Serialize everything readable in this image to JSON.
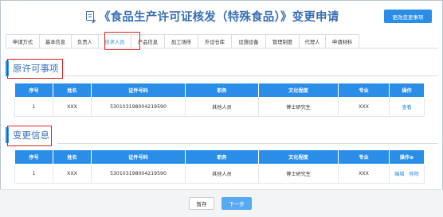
{
  "header": {
    "title": "《食品生产许可证核发（特殊食品）》变更申请",
    "change_button": "更改变更事项"
  },
  "tabs": [
    {
      "label": "申请方式"
    },
    {
      "label": "基本信息"
    },
    {
      "label": "负责人"
    },
    {
      "label": "技术人员"
    },
    {
      "label": "产品信息"
    },
    {
      "label": "加工场所"
    },
    {
      "label": "外设仓库"
    },
    {
      "label": "设施设备"
    },
    {
      "label": "管理制度"
    },
    {
      "label": "代理人"
    },
    {
      "label": "申请材料"
    }
  ],
  "active_tab": "技术人员",
  "original": {
    "title": "原许可事项",
    "columns": [
      "序号",
      "姓名",
      "证件号码",
      "职务",
      "文化程度",
      "专业",
      "操作"
    ],
    "rows": [
      {
        "no": "1",
        "name": "XXX",
        "id": "530103198004219590",
        "role": "其他人员",
        "edu": "博士研究生",
        "major": "XXX",
        "action": "查看"
      }
    ]
  },
  "changed": {
    "title": "变更信息",
    "columns": [
      "序号",
      "姓名",
      "证件号码",
      "职务",
      "文化程度",
      "专业",
      "操作⊕"
    ],
    "rows": [
      {
        "no": "1",
        "name": "XXX",
        "id": "530103198004219590",
        "role": "其他人员",
        "edu": "博士研究生",
        "major": "XXX",
        "edit": "编辑",
        "remove": "移除"
      }
    ]
  },
  "footer": {
    "save_label": "暂存",
    "next_label": "下一步"
  },
  "colors": {
    "accent": "#2a8de8",
    "title": "#3a6fb5",
    "highlight": "#e02020"
  }
}
